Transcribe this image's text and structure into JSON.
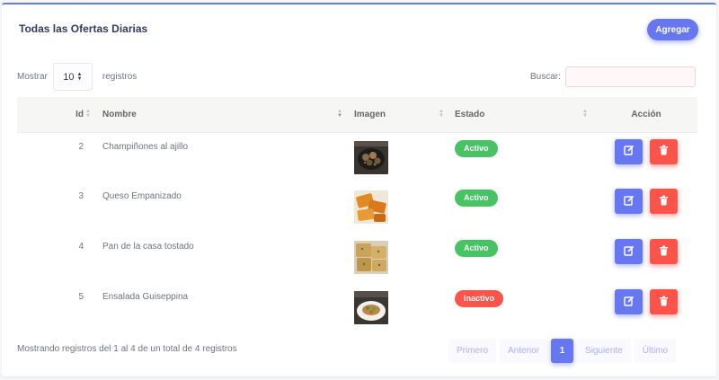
{
  "card": {
    "title": "Todas las Ofertas Diarias",
    "add_label": "Agregar"
  },
  "length": {
    "prefix": "Mostrar",
    "value": "10",
    "suffix": "registros"
  },
  "search": {
    "label": "Buscar:",
    "value": ""
  },
  "table": {
    "headers": [
      "Id",
      "Nombre",
      "Imagen",
      "Estado",
      "Acción"
    ],
    "rows": [
      {
        "id": "2",
        "name": "Champiñones al ajillo",
        "image": "mushrooms-dish-photo",
        "status": "Activo",
        "status_color": "#47c363"
      },
      {
        "id": "3",
        "name": "Queso Empanizado",
        "image": "breaded-cheese-photo",
        "status": "Activo",
        "status_color": "#47c363"
      },
      {
        "id": "4",
        "name": "Pan de la casa tostado",
        "image": "toasted-bread-photo",
        "status": "Activo",
        "status_color": "#47c363"
      },
      {
        "id": "5",
        "name": "Ensalada Guiseppina",
        "image": "salad-plate-photo",
        "status": "Inactivo",
        "status_color": "#fc544b"
      }
    ]
  },
  "footer": {
    "info": "Mostrando registros del 1 al 4 de un total de 4 registros",
    "pages": [
      "Primero",
      "Anterior",
      "1",
      "Siguiente",
      "Último"
    ]
  },
  "colors": {
    "primary": "#6777ef",
    "danger": "#fc544b",
    "success": "#47c363"
  }
}
